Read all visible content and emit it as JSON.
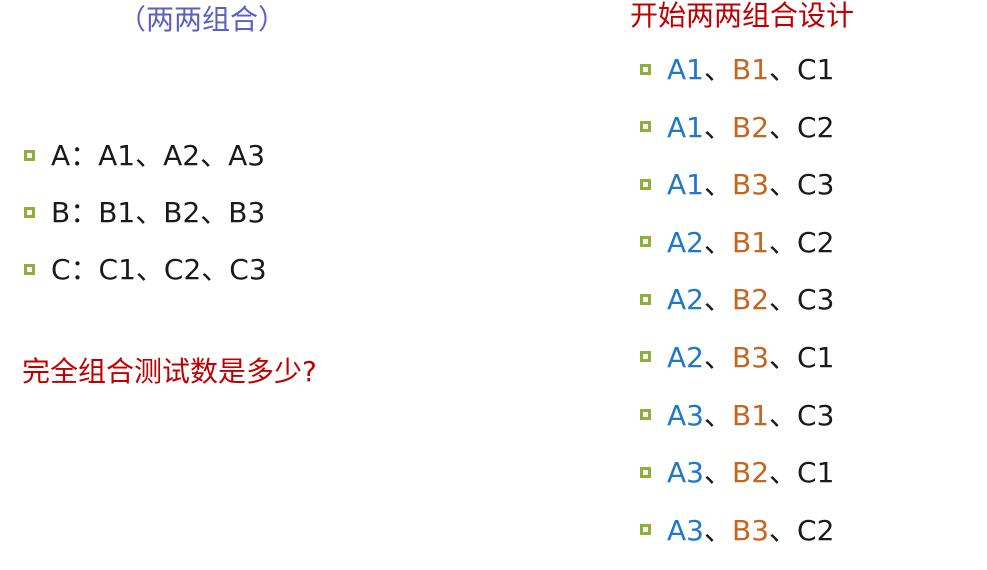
{
  "left_title": "（两两组合）",
  "right_title": "开始两两组合设计",
  "factors": [
    {
      "text": "A：A1、A2、A3"
    },
    {
      "text": "B：B1、B2、B3"
    },
    {
      "text": "C：C1、C2、C3"
    }
  ],
  "question": "完全组合测试数是多少?",
  "separator": "、",
  "combinations": [
    {
      "a": "A1",
      "b": "B1",
      "c": "C1"
    },
    {
      "a": "A1",
      "b": "B2",
      "c": "C2"
    },
    {
      "a": "A1",
      "b": "B3",
      "c": "C3"
    },
    {
      "a": "A2",
      "b": "B1",
      "c": "C2"
    },
    {
      "a": "A2",
      "b": "B2",
      "c": "C3"
    },
    {
      "a": "A2",
      "b": "B3",
      "c": "C1"
    },
    {
      "a": "A3",
      "b": "B1",
      "c": "C3"
    },
    {
      "a": "A3",
      "b": "B2",
      "c": "C1"
    },
    {
      "a": "A3",
      "b": "B3",
      "c": "C2"
    }
  ],
  "colors": {
    "left_title": "#5b5fc7",
    "right_title": "#c00000",
    "question": "#c00000",
    "bullet": "#8faf3c",
    "a_values": "#1f78c8",
    "b_values": "#c5651f",
    "c_values": "#1a1a1a"
  },
  "icons": {
    "bullet": "hollow-square-bullet-icon"
  }
}
